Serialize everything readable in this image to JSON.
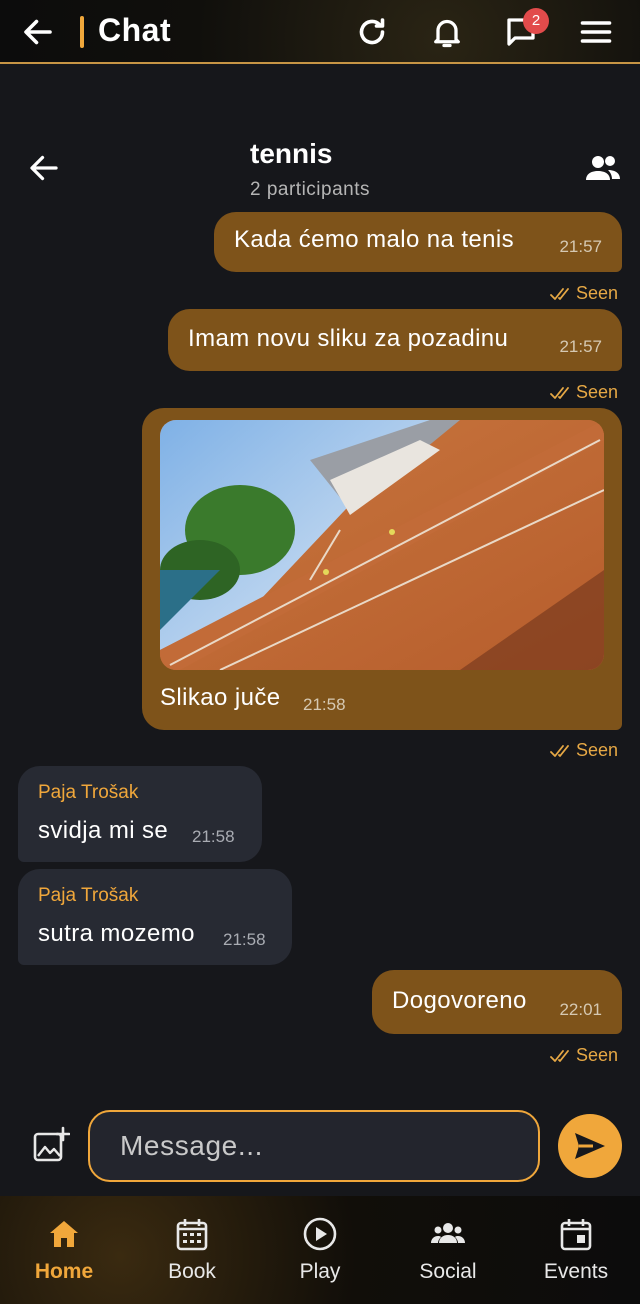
{
  "topbar": {
    "title": "Chat",
    "notification_badge": "2",
    "icons": [
      "arrow-left-icon",
      "refresh-icon",
      "bell-icon",
      "chat-icon",
      "menu-icon"
    ]
  },
  "chat": {
    "name": "tennis",
    "participants": "2 participants"
  },
  "messages": [
    {
      "id": "m1",
      "text": "Kada ćemo malo na tenis",
      "time": "21:57",
      "status": "Seen",
      "direction": "out"
    },
    {
      "id": "m2",
      "text": "Imam novu sliku za pozadinu",
      "time": "21:57",
      "status": "Seen",
      "direction": "out"
    },
    {
      "id": "m3",
      "text": "Slikao juče",
      "time": "21:58",
      "status": "Seen",
      "direction": "out",
      "has_image": true
    },
    {
      "id": "m4",
      "sender": "Paja Trošak",
      "text": "svidja mi se",
      "time": "21:58",
      "direction": "in"
    },
    {
      "id": "m5",
      "sender": "Paja Trošak",
      "text": "sutra mozemo",
      "time": "21:58",
      "direction": "in"
    },
    {
      "id": "m6",
      "text": "Dogovoreno",
      "time": "22:01",
      "status": "Seen",
      "direction": "out"
    }
  ],
  "composer": {
    "placeholder": "Message..."
  },
  "bottom_nav": [
    {
      "label": "Home",
      "icon": "home-icon",
      "active": true
    },
    {
      "label": "Book",
      "icon": "calendar-grid-icon",
      "active": false
    },
    {
      "label": "Play",
      "icon": "play-circle-icon",
      "active": false
    },
    {
      "label": "Social",
      "icon": "group-icon",
      "active": false
    },
    {
      "label": "Events",
      "icon": "event-icon",
      "active": false
    }
  ],
  "colors": {
    "accent": "#f0a73b",
    "outgoing_bubble": "#7e531a",
    "incoming_bubble": "#272a33",
    "background": "#16171b"
  }
}
